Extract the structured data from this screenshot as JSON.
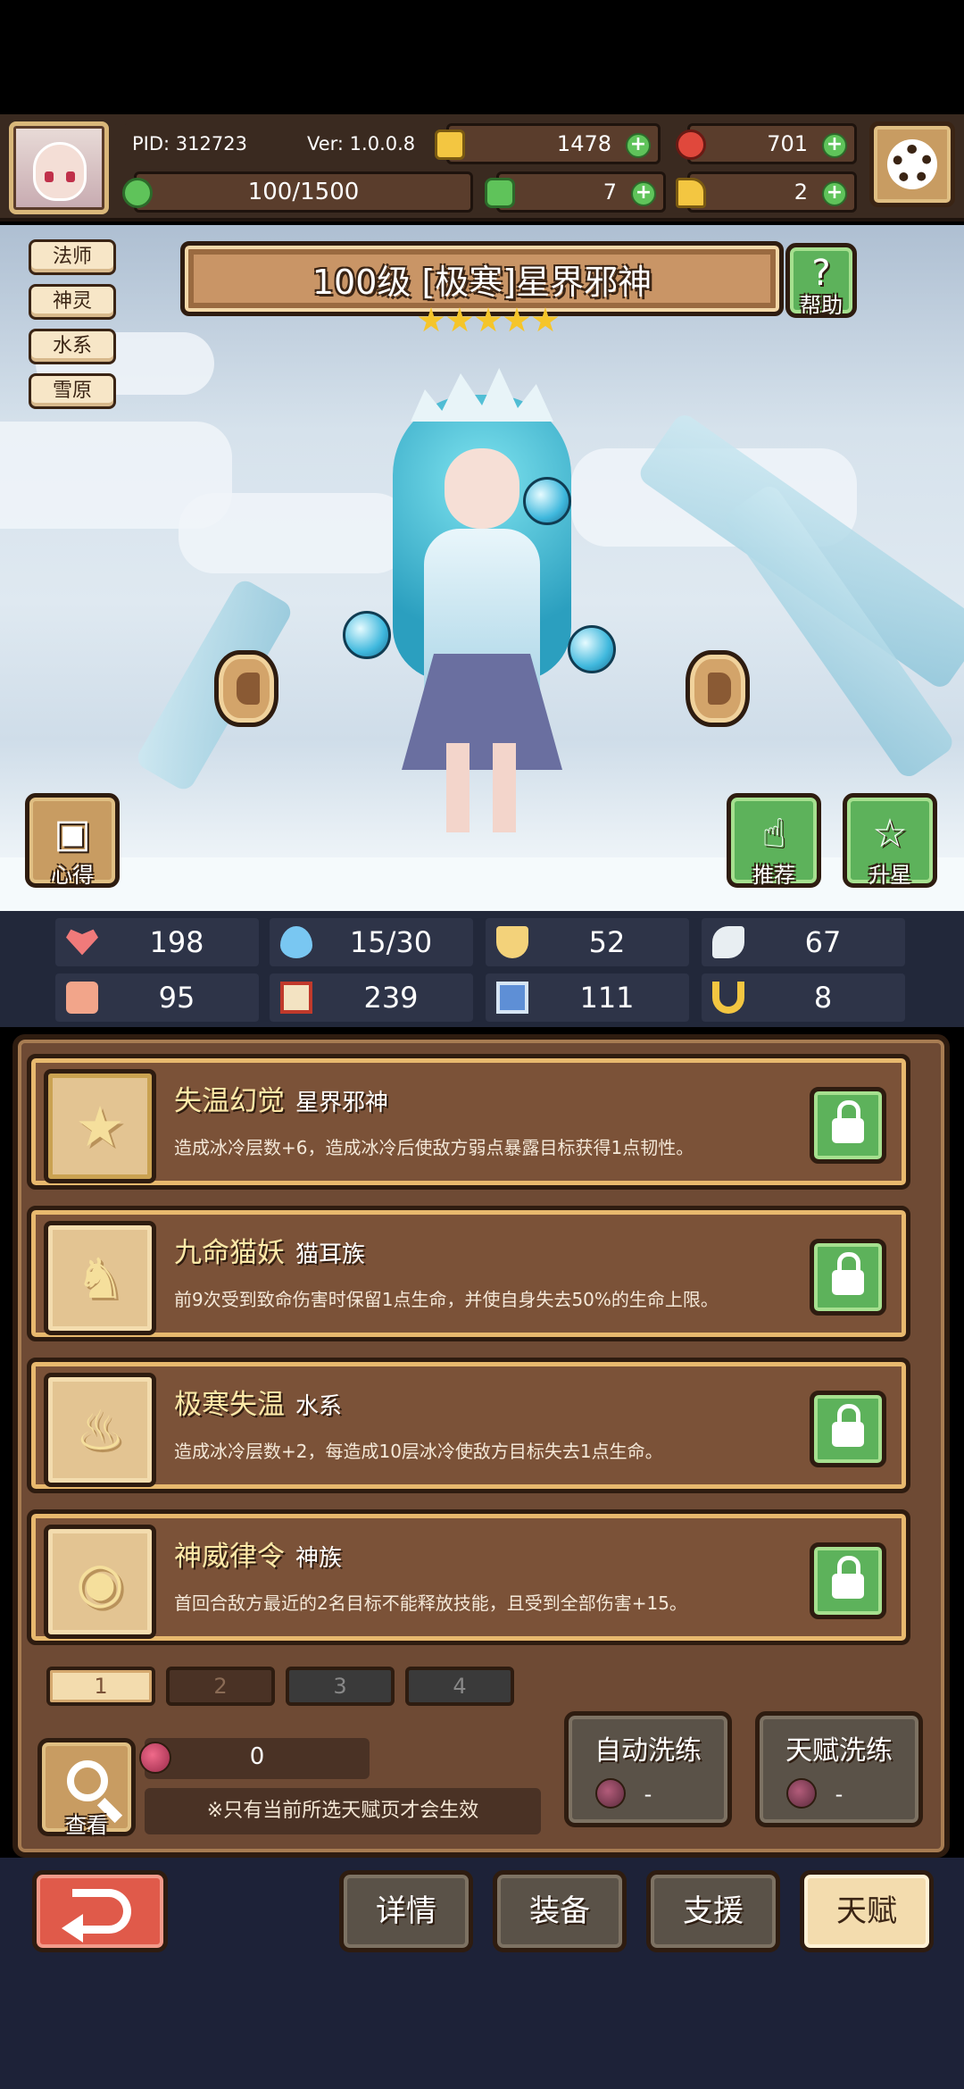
{
  "hud": {
    "pid": "PID: 312723",
    "version": "Ver: 1.0.0.8",
    "exp": "100/1500",
    "gold": "1478",
    "gems": "701",
    "clover": "7",
    "boot": "2"
  },
  "tags": [
    "法师",
    "神灵",
    "水系",
    "雪原"
  ],
  "hero": {
    "title": "100级 [极寒]星界邪神",
    "stars": 5,
    "help_label": "帮助",
    "notes_label": "心得",
    "recommend_label": "推荐",
    "upgrade_label": "升星"
  },
  "stats": {
    "hp": "198",
    "mana": "15/30",
    "defense": "52",
    "speed": "67",
    "attack": "95",
    "magic": "239",
    "armor": "111",
    "luck": "8"
  },
  "traits": [
    {
      "name": "失温幻觉",
      "sub": "星界邪神",
      "desc": "造成冰冷层数+6，造成冰冷后使敌方弱点暴露目标获得1点韧性。"
    },
    {
      "name": "九命猫妖",
      "sub": "猫耳族",
      "desc": "前9次受到致命伤害时保留1点生命，并使自身失去50%的生命上限。"
    },
    {
      "name": "极寒失温",
      "sub": "水系",
      "desc": "造成冰冷层数+2，每造成10层冰冷使敌方目标失去1点生命。"
    },
    {
      "name": "神威律令",
      "sub": "神族",
      "desc": "首回合敌方最近的2名目标不能释放技能，且受到全部伤害+15。"
    }
  ],
  "pages": [
    "1",
    "2",
    "3",
    "4"
  ],
  "bottom": {
    "look_label": "查看",
    "fruit_count": "0",
    "note": "※只有当前所选天赋页才会生效",
    "auto_wash": "自动洗练",
    "auto_wash_cost": "-",
    "talent_wash": "天赋洗练",
    "talent_wash_cost": "-"
  },
  "nav": {
    "details": "详情",
    "equip": "装备",
    "support": "支援",
    "talent": "天赋"
  },
  "colors": {
    "panel": "#6e4a34",
    "border": "#2e1c10",
    "accent_gold": "#e8b96e",
    "green_button": "#5db25b",
    "back_red": "#e05a4a"
  }
}
